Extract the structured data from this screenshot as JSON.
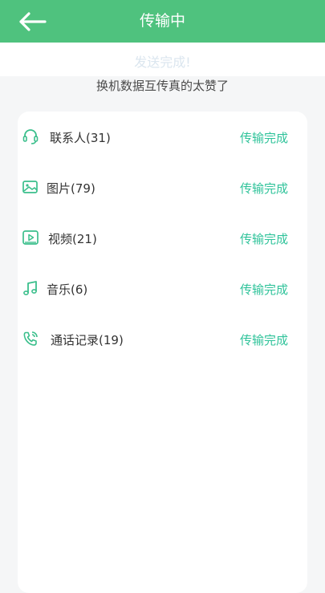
{
  "header": {
    "title": "传输中",
    "back_icon": "arrow-left-icon"
  },
  "status": {
    "title": "发送完成!",
    "subtitle": "换机数据互传真的太赞了"
  },
  "colors": {
    "accent": "#4fc27e",
    "success_text": "#2fc39a",
    "icon": "#3bbf8c"
  },
  "items": [
    {
      "icon": "headset-icon",
      "label": "联系人(31)",
      "status": "传输完成"
    },
    {
      "icon": "image-icon",
      "label": "图片(79)",
      "status": "传输完成"
    },
    {
      "icon": "video-icon",
      "label": "视频(21)",
      "status": "传输完成"
    },
    {
      "icon": "music-note-icon",
      "label": "音乐(6)",
      "status": "传输完成"
    },
    {
      "icon": "phone-call-icon",
      "label": "通话记录(19)",
      "status": "传输完成"
    }
  ]
}
